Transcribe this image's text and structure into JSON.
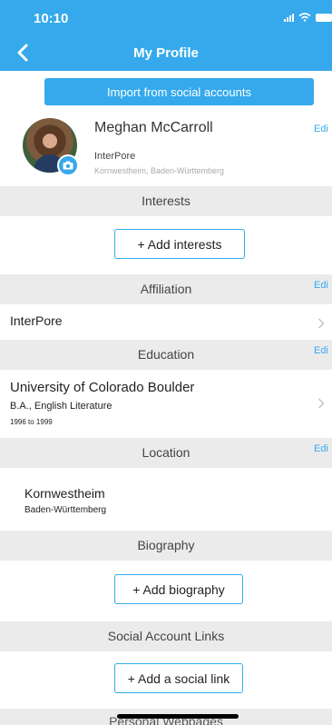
{
  "status": {
    "time": "10:10"
  },
  "nav": {
    "title": "My Profile"
  },
  "import_label": "Import from social accounts",
  "profile": {
    "name": "Meghan McCarroll",
    "organization": "InterPore",
    "location": "Kornwestheim, Baden-Württemberg",
    "edit": "Edi"
  },
  "sections": {
    "interests": {
      "title": "Interests",
      "add": "+ Add interests"
    },
    "affiliation": {
      "title": "Affiliation",
      "edit": "Edi",
      "value": "InterPore"
    },
    "education": {
      "title": "Education",
      "edit": "Edi",
      "school": "University of Colorado Boulder",
      "degree": "B.A., English Literature",
      "years": "1996 to 1999"
    },
    "location": {
      "title": "Location",
      "edit": "Edi",
      "city": "Kornwestheim",
      "region": "Baden-Württemberg"
    },
    "biography": {
      "title": "Biography",
      "add": "+ Add biography"
    },
    "social": {
      "title": "Social Account Links",
      "add": "+ Add a social link"
    },
    "webpages": {
      "title": "Personal Webpages"
    }
  },
  "colors": {
    "accent": "#35a9ec",
    "section_bg": "#ebebeb"
  },
  "icons": {
    "back": "chevron-left-icon",
    "camera": "camera-icon",
    "chevron": "chevron-right-icon",
    "signal": "signal-icon",
    "wifi": "wifi-icon",
    "battery": "battery-icon"
  }
}
